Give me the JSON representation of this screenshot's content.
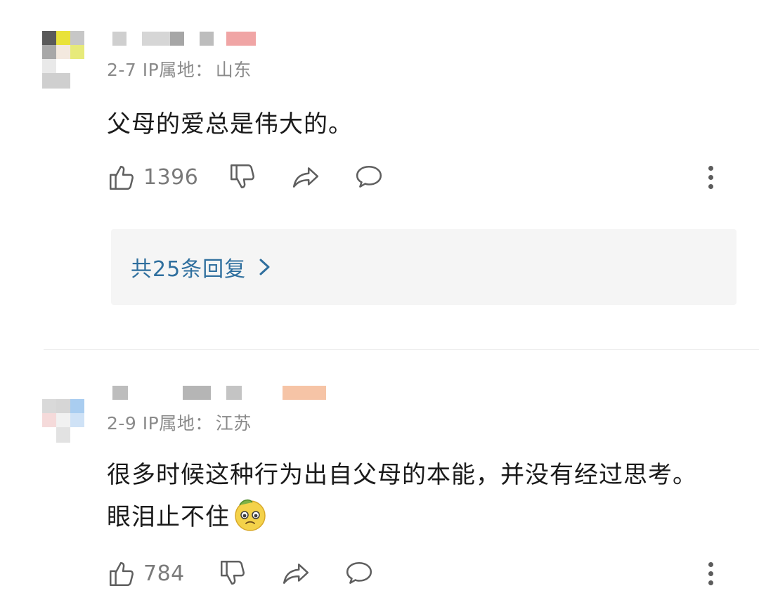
{
  "comments": [
    {
      "date": "2-7",
      "ip_label": "IP属地：",
      "location": "山东",
      "text": "父母的爱总是伟大的。",
      "likes": "1396",
      "replies_label": "共25条回复"
    },
    {
      "date": "2-9",
      "ip_label": "IP属地：",
      "location": "江苏",
      "text": "很多时候这种行为出自父母的本能，并没有经过思考。眼泪止不住",
      "likes": "784",
      "emoji": "pleading-face-emoji"
    }
  ],
  "icons": {
    "like": "thumbs-up-icon",
    "dislike": "thumbs-down-icon",
    "share": "share-icon",
    "comment": "comment-bubble-icon",
    "more": "more-vertical-icon",
    "chevron": "chevron-right-icon"
  },
  "colors": {
    "reply_link": "#2f6f9e",
    "meta_text": "#8a8a8a",
    "reply_box_bg": "#f5f5f5"
  }
}
